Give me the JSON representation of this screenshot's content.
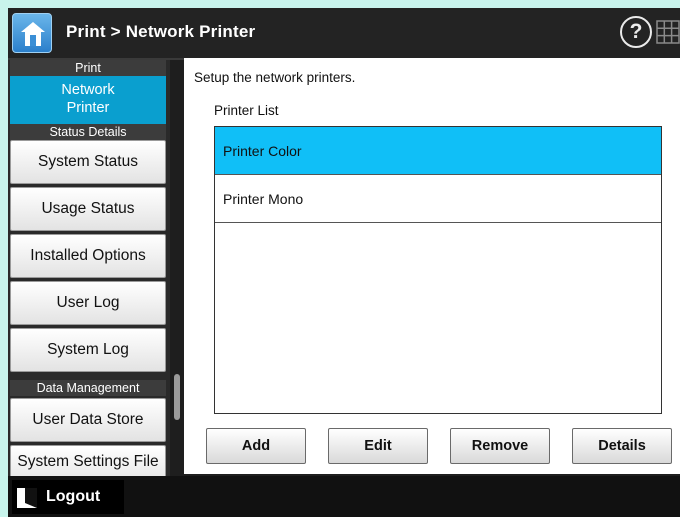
{
  "header": {
    "title": "Print > Network Printer",
    "help_label": "?"
  },
  "sidebar": {
    "print_section": "Print",
    "active_item": "Network\nPrinter",
    "status_section": "Status Details",
    "status_items": [
      "System Status",
      "Usage Status",
      "Installed Options",
      "User Log",
      "System Log"
    ],
    "data_section": "Data Management",
    "data_items": [
      "User Data Store",
      "System Settings File"
    ]
  },
  "main": {
    "description": "Setup the network printers.",
    "list_title": "Printer List",
    "printers": [
      {
        "name": "Printer Color",
        "selected": true
      },
      {
        "name": "Printer Mono",
        "selected": false
      }
    ],
    "buttons": {
      "add": "Add",
      "edit": "Edit",
      "remove": "Remove",
      "details": "Details"
    }
  },
  "footer": {
    "logout_label": "Logout"
  },
  "colors": {
    "background": "#c8f4ec",
    "active_nav": "#0a9fcf",
    "selected_row": "#10bff7"
  }
}
